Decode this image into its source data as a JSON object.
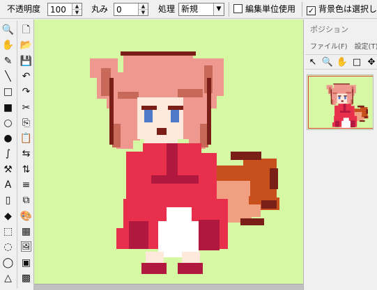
{
  "toolbar": {
    "opacity_label": "不透明度",
    "opacity_value": "100",
    "round_label": "丸み",
    "round_value": "0",
    "process_label": "処理",
    "process_value": "新規",
    "edit_unit_label": "編集単位使用",
    "edit_unit_checked": false,
    "bg_color_label": "背景色は選択しない",
    "bg_color_checked": true
  },
  "tools": [
    {
      "name": "zoom-icon",
      "glyph": "🔍"
    },
    {
      "name": "new-file-icon",
      "glyph": "🗋"
    },
    {
      "name": "hand-icon",
      "glyph": "✋"
    },
    {
      "name": "open-folder-icon",
      "glyph": "📂"
    },
    {
      "name": "pencil-icon",
      "glyph": "✎"
    },
    {
      "name": "save-icon",
      "glyph": "💾"
    },
    {
      "name": "line-icon",
      "glyph": "╲"
    },
    {
      "name": "undo-icon",
      "glyph": "↶"
    },
    {
      "name": "rectangle-icon",
      "glyph": "□"
    },
    {
      "name": "redo-icon",
      "glyph": "↷"
    },
    {
      "name": "filled-rectangle-icon",
      "glyph": "■"
    },
    {
      "name": "cut-icon",
      "glyph": "✂"
    },
    {
      "name": "ellipse-icon",
      "glyph": "○"
    },
    {
      "name": "copy-icon",
      "glyph": "⎘"
    },
    {
      "name": "filled-ellipse-icon",
      "glyph": "●"
    },
    {
      "name": "paste-icon",
      "glyph": "📋"
    },
    {
      "name": "curve-icon",
      "glyph": "∫"
    },
    {
      "name": "flip-horizontal-icon",
      "glyph": "⇆"
    },
    {
      "name": "fill-icon",
      "glyph": "⚒"
    },
    {
      "name": "flip-vertical-icon",
      "glyph": "⇅"
    },
    {
      "name": "text-icon",
      "glyph": "A"
    },
    {
      "name": "gradient-icon",
      "glyph": "≡"
    },
    {
      "name": "eraser-icon",
      "glyph": "▯"
    },
    {
      "name": "layers-icon",
      "glyph": "⧉"
    },
    {
      "name": "color-picker-icon",
      "glyph": "◆"
    },
    {
      "name": "palette-icon",
      "glyph": "🎨"
    },
    {
      "name": "rect-select-icon",
      "glyph": "⬚"
    },
    {
      "name": "film-icon",
      "glyph": "▦"
    },
    {
      "name": "ellipse-select-icon",
      "glyph": "◌"
    },
    {
      "name": "image-icon",
      "glyph": "🖼"
    },
    {
      "name": "lasso-select-icon",
      "glyph": "◯"
    },
    {
      "name": "frames-icon",
      "glyph": "▣"
    },
    {
      "name": "triangle-select-icon",
      "glyph": "△"
    },
    {
      "name": "grid-icon",
      "glyph": "▩"
    }
  ],
  "panel": {
    "title": "ポジション",
    "menu_file": "ファイル(F)",
    "menu_settings": "設定(T)",
    "tools": [
      {
        "name": "arrow-icon",
        "glyph": "↖"
      },
      {
        "name": "zoom-icon",
        "glyph": "🔍"
      },
      {
        "name": "hand-icon",
        "glyph": "✋"
      },
      {
        "name": "frame-icon",
        "glyph": "□"
      },
      {
        "name": "move-icon",
        "glyph": "✥"
      }
    ]
  },
  "colors": {
    "canvas_bg": "#d6f8a4",
    "hair": "#ee9890",
    "hair_dark": "#c86858",
    "outline": "#7a1e18",
    "dress": "#e8304c",
    "dress_dark": "#b01840",
    "skin": "#ffe8dc",
    "eyes": "#5078c8",
    "tail": "#c8501c",
    "tail_light": "#f0a080",
    "apron": "#ffffff"
  }
}
